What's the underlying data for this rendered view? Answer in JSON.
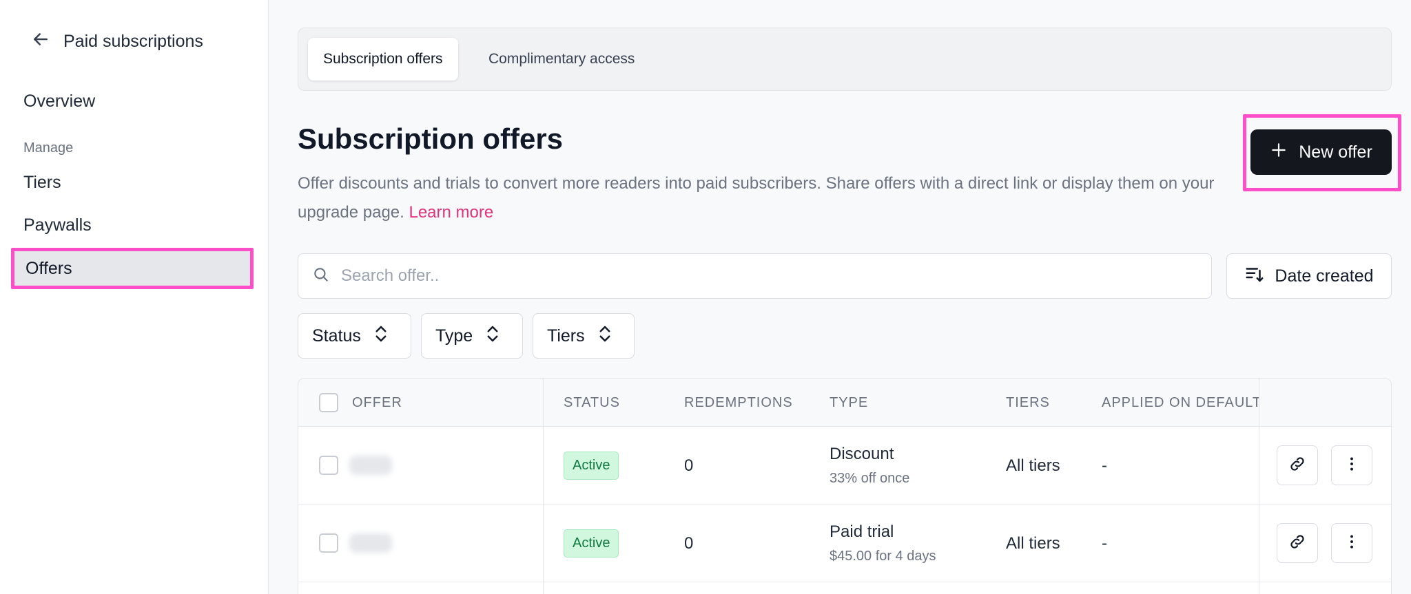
{
  "sidebar": {
    "back_label": "Paid subscriptions",
    "overview": "Overview",
    "section_manage": "Manage",
    "tiers": "Tiers",
    "paywalls": "Paywalls",
    "offers": "Offers"
  },
  "tabs": {
    "subscription_offers": "Subscription offers",
    "complimentary_access": "Complimentary access"
  },
  "header": {
    "title": "Subscription offers",
    "description": "Offer discounts and trials to convert more readers into paid subscribers. Share offers with a direct link or display them on your upgrade page.",
    "learn_more": "Learn more",
    "new_offer_label": "New offer"
  },
  "search": {
    "placeholder": "Search offer..",
    "value": ""
  },
  "sort": {
    "label": "Date created"
  },
  "filters": {
    "status": "Status",
    "type": "Type",
    "tiers": "Tiers"
  },
  "table": {
    "columns": {
      "offer": "OFFER",
      "status": "STATUS",
      "redemptions": "REDEMPTIONS",
      "type": "TYPE",
      "tiers": "TIERS",
      "applied_on_default": "APPLIED ON DEFAULT"
    },
    "rows": [
      {
        "status": "Active",
        "redemptions": "0",
        "type": "Discount",
        "type_detail": "33% off once",
        "tiers": "All tiers",
        "applied_on_default": "-"
      },
      {
        "status": "Active",
        "redemptions": "0",
        "type": "Paid trial",
        "type_detail": "$45.00 for 4 days",
        "tiers": "All tiers",
        "applied_on_default": "-"
      }
    ]
  },
  "colors": {
    "accent_pink": "#e2337d",
    "highlight": "#ff4fc8",
    "primary_button": "#15171f",
    "badge_active_bg": "#d1f7df",
    "badge_active_text": "#117a3f"
  }
}
